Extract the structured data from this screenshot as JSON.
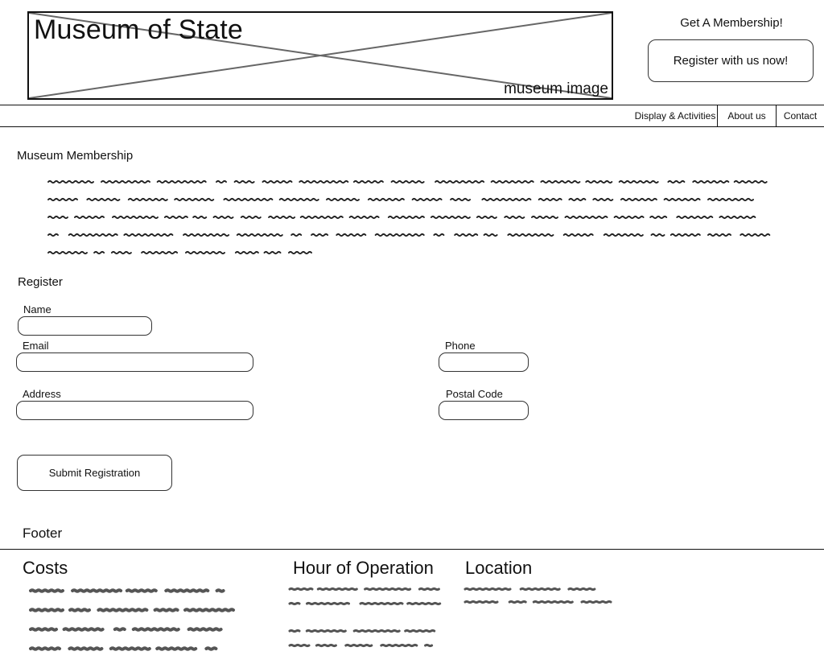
{
  "header": {
    "title": "Museum of State",
    "image_caption": "museum image",
    "membership_heading": "Get A Membership!",
    "register_cta": "Register with us now!"
  },
  "nav": {
    "items": [
      {
        "label": "Display & Activities",
        "icon": "none"
      },
      {
        "label": "About us",
        "icon": "none"
      },
      {
        "label": "Contact",
        "icon": "none"
      }
    ]
  },
  "membership": {
    "heading": "Museum Membership"
  },
  "register": {
    "heading": "Register",
    "fields": {
      "name": {
        "label": "Name",
        "value": "",
        "placeholder": ""
      },
      "email": {
        "label": "Email",
        "value": "",
        "placeholder": ""
      },
      "phone": {
        "label": "Phone",
        "value": "",
        "placeholder": ""
      },
      "address": {
        "label": "Address",
        "value": "",
        "placeholder": ""
      },
      "postal_code": {
        "label": "Postal Code",
        "value": "",
        "placeholder": ""
      }
    },
    "submit_label": "Submit Registration"
  },
  "footer": {
    "label": "Footer",
    "columns": [
      {
        "heading": "Costs"
      },
      {
        "heading": "Hour of Operation"
      },
      {
        "heading": "Location"
      }
    ]
  },
  "colors": {
    "border": "#111111",
    "scribble": "#222222",
    "footer_scribble": "#555555",
    "background": "#ffffff"
  }
}
